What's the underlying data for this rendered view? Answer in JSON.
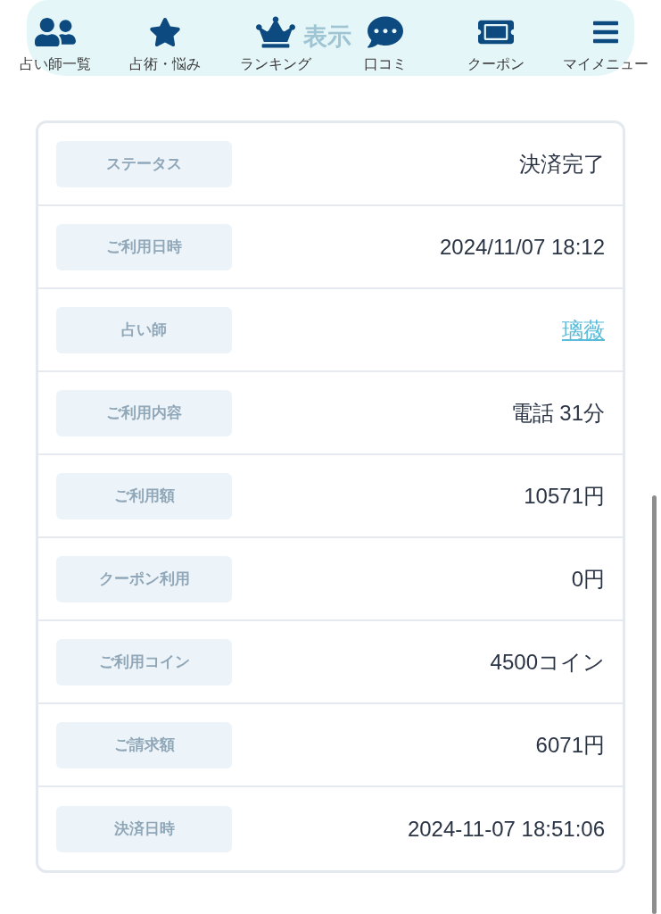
{
  "nav": {
    "items": [
      {
        "label": "占い師一覧"
      },
      {
        "label": "占術・悩み"
      },
      {
        "label": "ランキング"
      },
      {
        "label": "口コミ"
      },
      {
        "label": "クーポン"
      },
      {
        "label": "マイメニュー"
      }
    ],
    "overlay_label": "表示"
  },
  "details": {
    "rows": [
      {
        "label": "ステータス",
        "value": "決済完了",
        "kind": "text"
      },
      {
        "label": "ご利用日時",
        "value": "2024/11/07 18:12",
        "kind": "text"
      },
      {
        "label": "占い師",
        "value": "璃薇",
        "kind": "link"
      },
      {
        "label": "ご利用内容",
        "value": "電話 31分",
        "kind": "text"
      },
      {
        "label": "ご利用額",
        "value": "10571円",
        "kind": "text"
      },
      {
        "label": "クーポン利用",
        "value": "0円",
        "kind": "text"
      },
      {
        "label": "ご利用コイン",
        "value": "4500コイン",
        "kind": "text"
      },
      {
        "label": "ご請求額",
        "value": "6071円",
        "kind": "text"
      },
      {
        "label": "決済日時",
        "value": "2024-11-07 18:51:06",
        "kind": "text"
      }
    ]
  }
}
